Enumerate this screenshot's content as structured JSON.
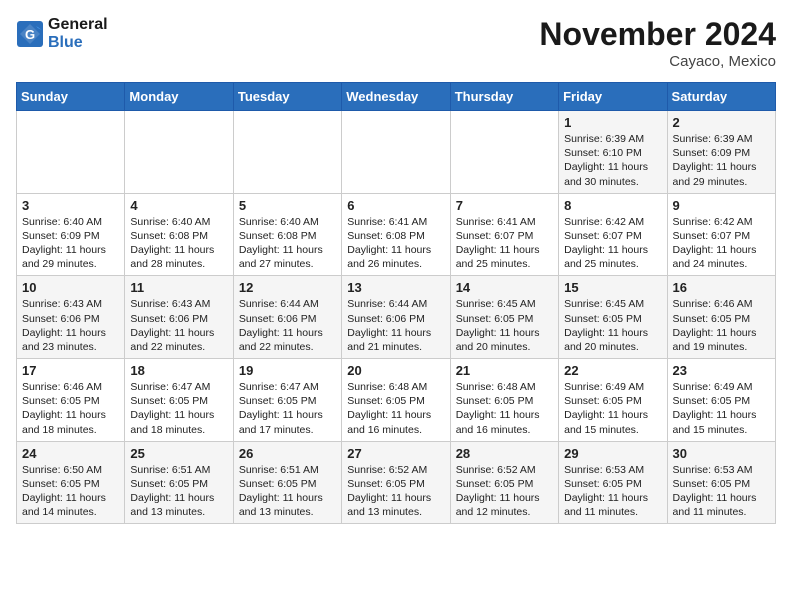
{
  "logo": {
    "line1": "General",
    "line2": "Blue"
  },
  "title": "November 2024",
  "location": "Cayaco, Mexico",
  "days_of_week": [
    "Sunday",
    "Monday",
    "Tuesday",
    "Wednesday",
    "Thursday",
    "Friday",
    "Saturday"
  ],
  "weeks": [
    [
      {
        "day": "",
        "content": ""
      },
      {
        "day": "",
        "content": ""
      },
      {
        "day": "",
        "content": ""
      },
      {
        "day": "",
        "content": ""
      },
      {
        "day": "",
        "content": ""
      },
      {
        "day": "1",
        "content": "Sunrise: 6:39 AM\nSunset: 6:10 PM\nDaylight: 11 hours and 30 minutes."
      },
      {
        "day": "2",
        "content": "Sunrise: 6:39 AM\nSunset: 6:09 PM\nDaylight: 11 hours and 29 minutes."
      }
    ],
    [
      {
        "day": "3",
        "content": "Sunrise: 6:40 AM\nSunset: 6:09 PM\nDaylight: 11 hours and 29 minutes."
      },
      {
        "day": "4",
        "content": "Sunrise: 6:40 AM\nSunset: 6:08 PM\nDaylight: 11 hours and 28 minutes."
      },
      {
        "day": "5",
        "content": "Sunrise: 6:40 AM\nSunset: 6:08 PM\nDaylight: 11 hours and 27 minutes."
      },
      {
        "day": "6",
        "content": "Sunrise: 6:41 AM\nSunset: 6:08 PM\nDaylight: 11 hours and 26 minutes."
      },
      {
        "day": "7",
        "content": "Sunrise: 6:41 AM\nSunset: 6:07 PM\nDaylight: 11 hours and 25 minutes."
      },
      {
        "day": "8",
        "content": "Sunrise: 6:42 AM\nSunset: 6:07 PM\nDaylight: 11 hours and 25 minutes."
      },
      {
        "day": "9",
        "content": "Sunrise: 6:42 AM\nSunset: 6:07 PM\nDaylight: 11 hours and 24 minutes."
      }
    ],
    [
      {
        "day": "10",
        "content": "Sunrise: 6:43 AM\nSunset: 6:06 PM\nDaylight: 11 hours and 23 minutes."
      },
      {
        "day": "11",
        "content": "Sunrise: 6:43 AM\nSunset: 6:06 PM\nDaylight: 11 hours and 22 minutes."
      },
      {
        "day": "12",
        "content": "Sunrise: 6:44 AM\nSunset: 6:06 PM\nDaylight: 11 hours and 22 minutes."
      },
      {
        "day": "13",
        "content": "Sunrise: 6:44 AM\nSunset: 6:06 PM\nDaylight: 11 hours and 21 minutes."
      },
      {
        "day": "14",
        "content": "Sunrise: 6:45 AM\nSunset: 6:05 PM\nDaylight: 11 hours and 20 minutes."
      },
      {
        "day": "15",
        "content": "Sunrise: 6:45 AM\nSunset: 6:05 PM\nDaylight: 11 hours and 20 minutes."
      },
      {
        "day": "16",
        "content": "Sunrise: 6:46 AM\nSunset: 6:05 PM\nDaylight: 11 hours and 19 minutes."
      }
    ],
    [
      {
        "day": "17",
        "content": "Sunrise: 6:46 AM\nSunset: 6:05 PM\nDaylight: 11 hours and 18 minutes."
      },
      {
        "day": "18",
        "content": "Sunrise: 6:47 AM\nSunset: 6:05 PM\nDaylight: 11 hours and 18 minutes."
      },
      {
        "day": "19",
        "content": "Sunrise: 6:47 AM\nSunset: 6:05 PM\nDaylight: 11 hours and 17 minutes."
      },
      {
        "day": "20",
        "content": "Sunrise: 6:48 AM\nSunset: 6:05 PM\nDaylight: 11 hours and 16 minutes."
      },
      {
        "day": "21",
        "content": "Sunrise: 6:48 AM\nSunset: 6:05 PM\nDaylight: 11 hours and 16 minutes."
      },
      {
        "day": "22",
        "content": "Sunrise: 6:49 AM\nSunset: 6:05 PM\nDaylight: 11 hours and 15 minutes."
      },
      {
        "day": "23",
        "content": "Sunrise: 6:49 AM\nSunset: 6:05 PM\nDaylight: 11 hours and 15 minutes."
      }
    ],
    [
      {
        "day": "24",
        "content": "Sunrise: 6:50 AM\nSunset: 6:05 PM\nDaylight: 11 hours and 14 minutes."
      },
      {
        "day": "25",
        "content": "Sunrise: 6:51 AM\nSunset: 6:05 PM\nDaylight: 11 hours and 13 minutes."
      },
      {
        "day": "26",
        "content": "Sunrise: 6:51 AM\nSunset: 6:05 PM\nDaylight: 11 hours and 13 minutes."
      },
      {
        "day": "27",
        "content": "Sunrise: 6:52 AM\nSunset: 6:05 PM\nDaylight: 11 hours and 13 minutes."
      },
      {
        "day": "28",
        "content": "Sunrise: 6:52 AM\nSunset: 6:05 PM\nDaylight: 11 hours and 12 minutes."
      },
      {
        "day": "29",
        "content": "Sunrise: 6:53 AM\nSunset: 6:05 PM\nDaylight: 11 hours and 11 minutes."
      },
      {
        "day": "30",
        "content": "Sunrise: 6:53 AM\nSunset: 6:05 PM\nDaylight: 11 hours and 11 minutes."
      }
    ]
  ]
}
